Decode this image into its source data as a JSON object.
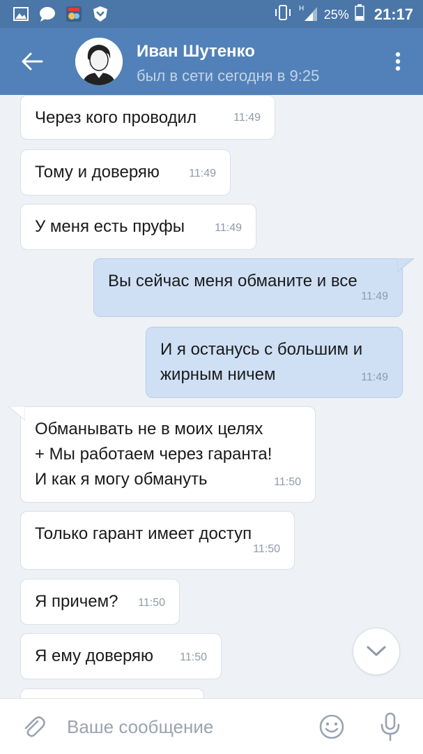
{
  "status_bar": {
    "battery": "25%",
    "time": "21:17",
    "network": "H",
    "icons": [
      "gallery-icon",
      "chat-bubble-icon",
      "game-icon",
      "vk-shield-icon",
      "vibrate-icon",
      "signal-icon",
      "battery-icon"
    ]
  },
  "header": {
    "name": "Иван Шутенко",
    "status": "был в сети сегодня в 9:25",
    "back_icon": "arrow-left-icon",
    "menu_icon": "more-vert-icon"
  },
  "messages": [
    {
      "dir": "in",
      "text": "Через кого проводил",
      "time": "11:49"
    },
    {
      "dir": "in",
      "text": "Тому и доверяю",
      "time": "11:49"
    },
    {
      "dir": "in",
      "text": "У меня есть пруфы",
      "time": "11:49"
    },
    {
      "dir": "out",
      "text": "Вы сейчас меня обманите и все",
      "time": "11:49"
    },
    {
      "dir": "out",
      "text": "И я останусь с большим и\nжирным ничем",
      "time": "11:49"
    },
    {
      "dir": "in",
      "text": "Обманывать не в моих целях\n+ Мы работаем через гаранта!\nИ как я могу обмануть",
      "time": "11:50"
    },
    {
      "dir": "in",
      "text": "Только гарант имеет доступ",
      "time": "11:50"
    },
    {
      "dir": "in",
      "text": "Я причем?",
      "time": "11:50"
    },
    {
      "dir": "in",
      "text": "Я ему доверяю",
      "time": "11:50"
    }
  ],
  "composer": {
    "placeholder": "Ваше сообщение",
    "attach_icon": "paperclip-icon",
    "emoji_icon": "smiley-icon",
    "mic_icon": "microphone-icon"
  },
  "scroll_down_icon": "chevron-down-icon",
  "colors": {
    "status_bar": "#4a76a8",
    "header": "#5181b8",
    "background": "#eef1f5",
    "incoming_bubble": "#ffffff",
    "outgoing_bubble": "#cfe0f5"
  }
}
